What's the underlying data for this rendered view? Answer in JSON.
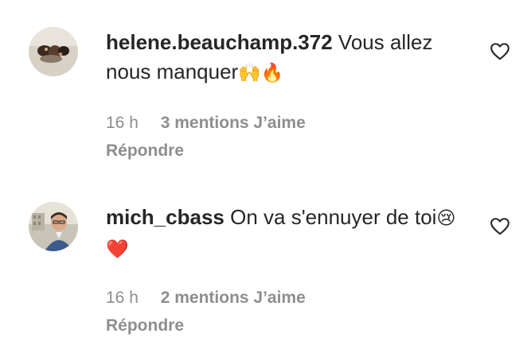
{
  "comments": [
    {
      "username": "helene.beauchamp.372",
      "text": "Vous allez nous manquer",
      "emoji": "🙌🔥",
      "time": "16 h",
      "likes": "3 mentions J’aime",
      "reply": "Répondre",
      "avatar_icon": "avatar-photo-icon"
    },
    {
      "username": "mich_cbass",
      "text": "On va s'ennuyer de toi",
      "emoji": "😢❤️",
      "time": "16 h",
      "likes": "2 mentions J’aime",
      "reply": "Répondre",
      "avatar_icon": "avatar-photo-icon"
    }
  ],
  "colors": {
    "text": "#262626",
    "secondary": "#8e8e8e",
    "background": "#ffffff"
  },
  "icons": {
    "like": "heart-outline-icon"
  }
}
